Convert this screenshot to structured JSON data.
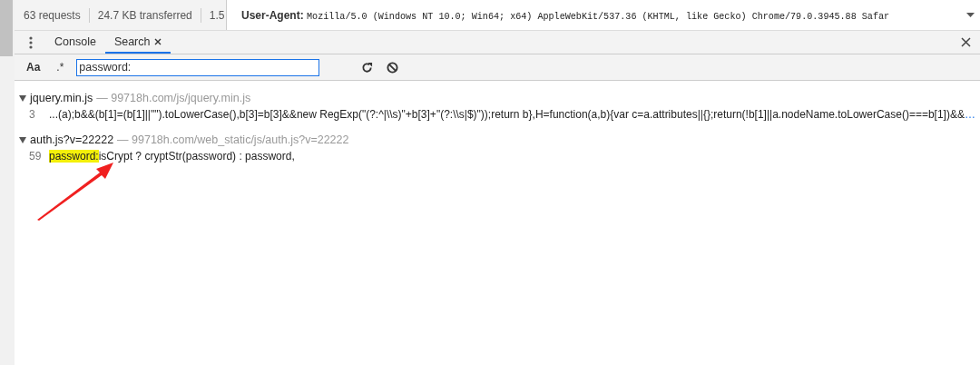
{
  "network_summary": [
    "63 requests",
    "24.7 KB transferred",
    "1.5"
  ],
  "header": {
    "name": "User-Agent:",
    "value": "Mozilla/5.0 (Windows NT 10.0; Win64; x64) AppleWebKit/537.36 (KHTML, like Gecko) Chrome/79.0.3945.88 Safar"
  },
  "drawer_tabs": [
    {
      "label": "Console",
      "selected": false,
      "closable": false
    },
    {
      "label": "Search",
      "selected": true,
      "closable": true
    }
  ],
  "search": {
    "case_toggle": "Aa",
    "regex_toggle": ".*",
    "value": "password:"
  },
  "results": [
    {
      "file": "jquery.min.js",
      "path": "— 99718h.com/js/jquery.min.js",
      "expanded": true,
      "matches": [
        {
          "line": "3",
          "text": "...(a);b&&(b[1]=(b[1]||\"\").toLowerCase(),b[3]=b[3]&&new RegExp(\"(?:^|\\\\s)\"+b[3]+\"(?:\\\\s|$)\"));return b},H=function(a,b){var c=a.attributes||{};return(!b[1]||a.nodeName.toLowerCase()===b[1])&&",
          "more": "…"
        }
      ]
    },
    {
      "file": "auth.js?v=22222",
      "path": "— 99718h.com/web_static/js/auth.js?v=22222",
      "expanded": true,
      "matches": [
        {
          "line": "59",
          "highlight": "password:",
          "text": " isCrypt ? cryptStr(password) : password,"
        }
      ]
    }
  ]
}
